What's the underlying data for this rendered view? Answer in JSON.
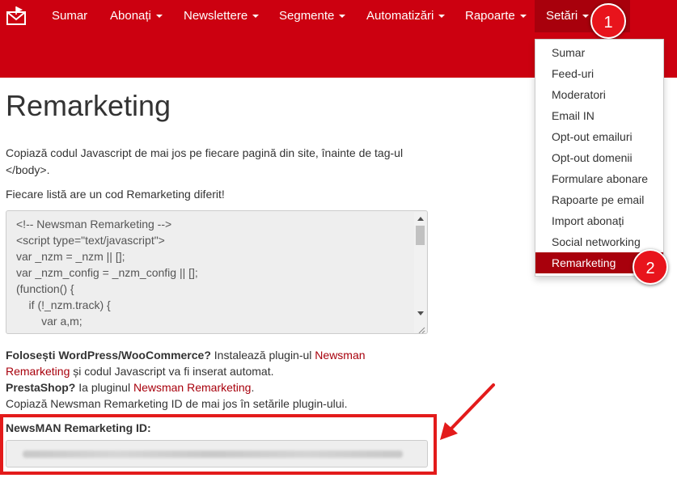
{
  "colors": {
    "brand": "#cc0010",
    "active": "#a8000c",
    "badge": "#e8141c",
    "link": "#a8000c"
  },
  "nav": {
    "logo_icon": "envelope-logo",
    "items": [
      {
        "label": "Sumar",
        "has_caret": false
      },
      {
        "label": "Abonați",
        "has_caret": true
      },
      {
        "label": "Newslettere",
        "has_caret": true
      },
      {
        "label": "Segmente",
        "has_caret": true
      },
      {
        "label": "Automatizări",
        "has_caret": true
      },
      {
        "label": "Rapoarte",
        "has_caret": true
      },
      {
        "label": "Setări",
        "has_caret": true,
        "active": true
      }
    ]
  },
  "badges": {
    "first": "1",
    "second": "2"
  },
  "dropdown": {
    "items": [
      {
        "label": "Sumar"
      },
      {
        "label": "Feed-uri"
      },
      {
        "label": "Moderatori"
      },
      {
        "label": "Email IN"
      },
      {
        "label": "Opt-out emailuri"
      },
      {
        "label": "Opt-out domenii"
      },
      {
        "label": "Formulare abonare"
      },
      {
        "label": "Rapoarte pe email"
      },
      {
        "label": "Import abonați"
      },
      {
        "label": "Social networking"
      },
      {
        "label": "Remarketing",
        "active": true
      }
    ]
  },
  "page": {
    "title": "Remarketing",
    "intro_line1": "Copiază codul Javascript de mai jos pe fiecare pagină din site, înainte de tag-ul",
    "intro_line2": "</body>.",
    "intro_note": "Fiecare listă are un cod Remarketing diferit!"
  },
  "code": {
    "lines": [
      "<!-- Newsman Remarketing -->",
      "<script type=\"text/javascript\">",
      "var _nzm = _nzm || [];",
      "var _nzm_config = _nzm_config || [];",
      "(function() {",
      "    if (!_nzm.track) {",
      "        var a,m;"
    ]
  },
  "info": {
    "wp_bold": "Folosești WordPress/WooCommerce?",
    "wp_text": " Instalează plugin-ul ",
    "wp_link1": "Newsman",
    "wp_link2": "Remarketing",
    "wp_text2": " și codul Javascript va fi inserat automat.",
    "ps_bold": "PrestaShop?",
    "ps_text": " Ia pluginul ",
    "ps_link": "Newsman Remarketing",
    "ps_end": ".",
    "copy_text": "Copiază Newsman Remarketing ID de mai jos în setările plugin-ului."
  },
  "remarketing_id": {
    "label": "NewsMAN Remarketing ID:"
  }
}
